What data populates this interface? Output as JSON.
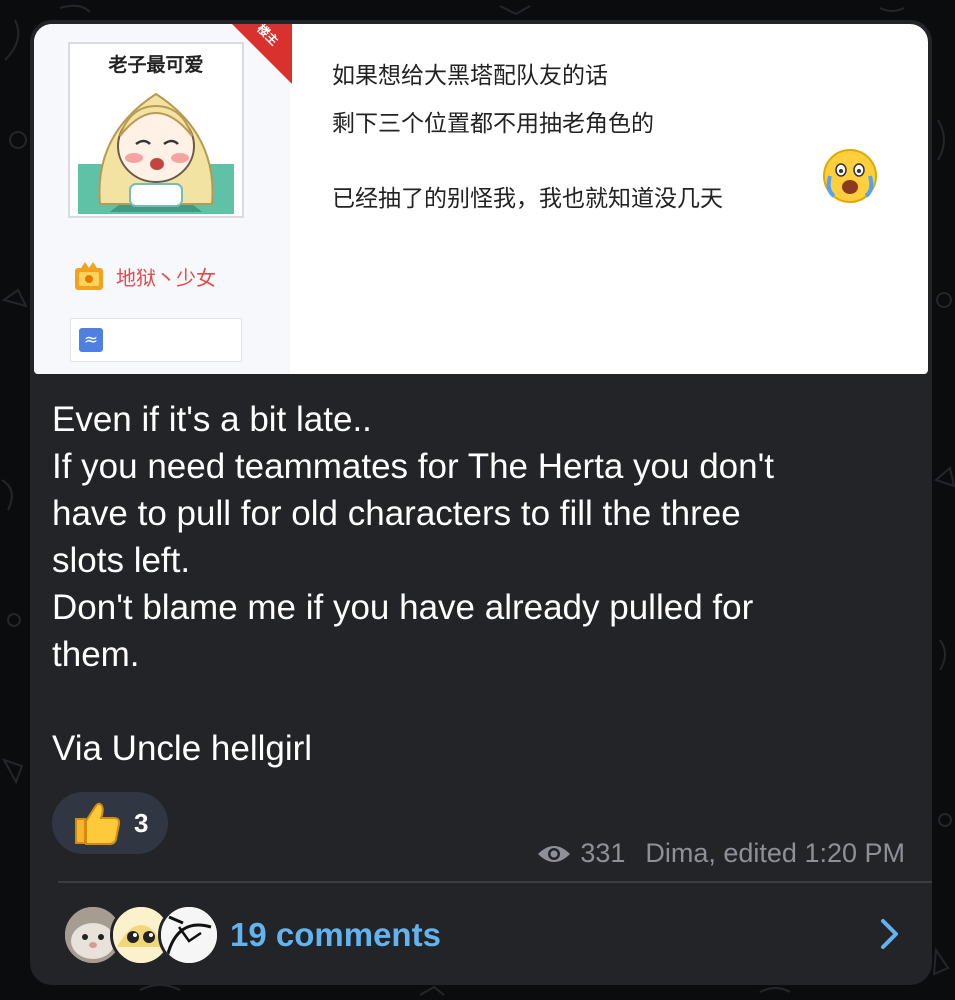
{
  "embed": {
    "avatar_title": "老子最可爱",
    "corner_badge": "楼主",
    "username": "地狱丶少女",
    "lines": [
      "如果想给大黑塔配队友的话",
      "剩下三个位置都不用抽老角色的",
      "已经抽了的别怪我，我也就知道没几天"
    ]
  },
  "message": {
    "lines": [
      "Even if it's a bit late..",
      "If you need teammates for The Herta you don't",
      "have to pull for old characters to fill the three",
      "slots left.",
      "Don't blame me if you have already pulled for",
      "them.",
      "",
      "Via Uncle hellgirl"
    ]
  },
  "reaction": {
    "emoji": "thumbs-up-icon",
    "count": "3"
  },
  "meta": {
    "views": "331",
    "author_time": "Dima, edited 1:20 PM"
  },
  "comments": {
    "label": "19 comments"
  },
  "colors": {
    "bubble": "#232428",
    "link": "#63b3ef",
    "meta": "#8d9098",
    "username": "#e24b4b"
  }
}
